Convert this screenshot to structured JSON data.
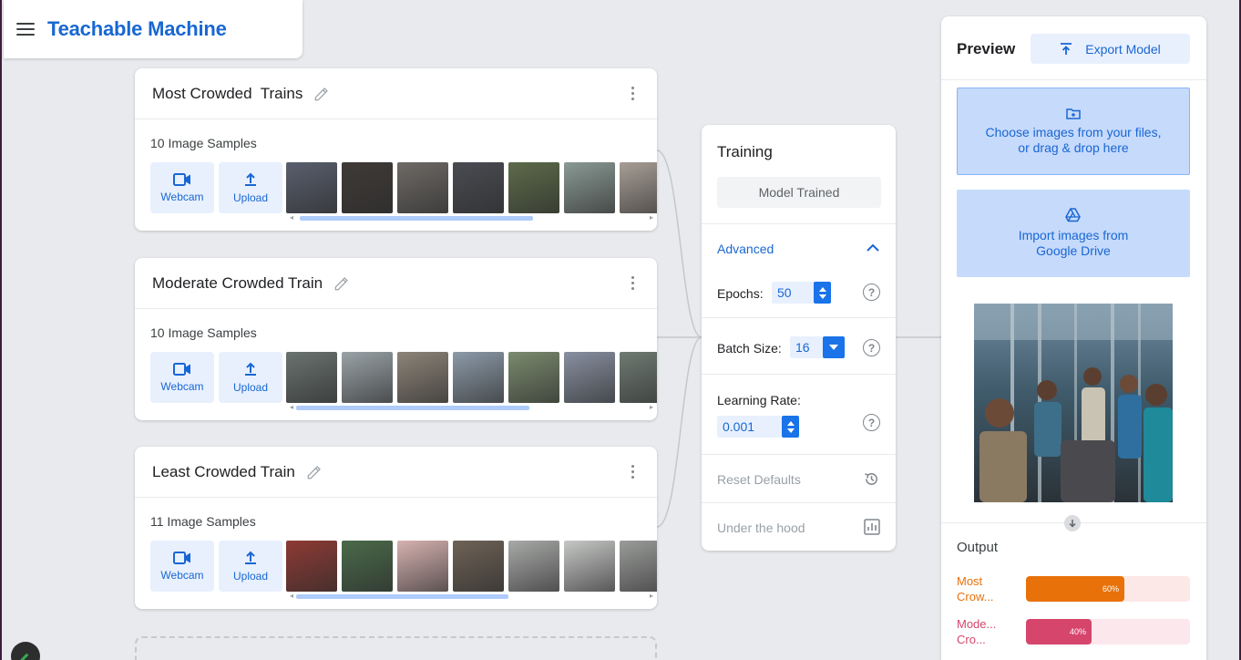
{
  "header": {
    "title": "Teachable Machine"
  },
  "classes": [
    {
      "name": "Most Crowded  Trains",
      "samples": "10 Image Samples",
      "webcam_label": "Webcam",
      "upload_label": "Upload",
      "thumb_colors": [
        "#5a5f6e",
        "#3f3a37",
        "#6e6a66",
        "#4a4c52",
        "#5d6b4a",
        "#8a9a94",
        "#a79e96"
      ]
    },
    {
      "name": "Moderate Crowded Train",
      "samples": "10 Image Samples",
      "webcam_label": "Webcam",
      "upload_label": "Upload",
      "thumb_colors": [
        "#6a7370",
        "#9aa3a7",
        "#8d8478",
        "#8c9aa8",
        "#7a8a6e",
        "#8890a0",
        "#6e7a72"
      ]
    },
    {
      "name": "Least Crowded Train",
      "samples": "11 Image Samples",
      "webcam_label": "Webcam",
      "upload_label": "Upload",
      "thumb_colors": [
        "#8e3a34",
        "#4a6a4a",
        "#d6b2b0",
        "#6e6256",
        "#a8aaa8",
        "#c6c8c6",
        "#9a9c9a"
      ]
    }
  ],
  "training": {
    "title": "Training",
    "status": "Model Trained",
    "advanced_label": "Advanced",
    "epochs_label": "Epochs:",
    "epochs_value": "50",
    "batch_label": "Batch Size:",
    "batch_value": "16",
    "lr_label": "Learning Rate:",
    "lr_value": "0.001",
    "reset_label": "Reset Defaults",
    "hood_label": "Under the hood",
    "help_glyph": "?"
  },
  "preview": {
    "title": "Preview",
    "export_label": "Export Model",
    "files_line1": "Choose images from your files,",
    "files_line2": "or drag & drop here",
    "drive_line1": "Import images from",
    "drive_line2": "Google Drive",
    "output_label": "Output",
    "outputs": [
      {
        "line1": "Most",
        "line2": "Crow...",
        "percent": 60,
        "percent_label": "60%",
        "color": "#e8710a",
        "track": "#fce8e6",
        "text_color": "#e8710a"
      },
      {
        "line1": "Mode...",
        "line2": "Cro...",
        "percent": 40,
        "percent_label": "40%",
        "color": "#d6456c",
        "track": "#fce8ec",
        "text_color": "#d6456c"
      }
    ]
  },
  "colors": {
    "accent": "#1967d2",
    "tile_bg": "#e8f0fe",
    "drop_zone": "#c6dafc"
  }
}
